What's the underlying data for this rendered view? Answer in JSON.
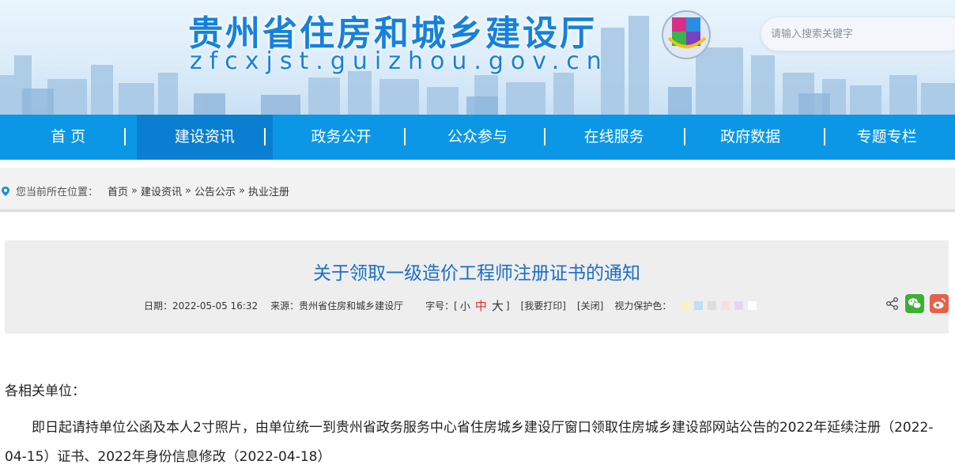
{
  "header": {
    "site_title": "贵州省住房和城乡建设厅",
    "site_url": "zfcxjst.guizhou.gov.cn",
    "search_placeholder": "请输入搜索关键字"
  },
  "nav": {
    "items": [
      {
        "label": "首 页"
      },
      {
        "label": "建设资讯"
      },
      {
        "label": "政务公开"
      },
      {
        "label": "公众参与"
      },
      {
        "label": "在线服务"
      },
      {
        "label": "政府数据"
      },
      {
        "label": "专题专栏"
      }
    ],
    "active_index": 1
  },
  "breadcrumb": {
    "prefix": "您当前所在位置：",
    "items": [
      "首页",
      "建设资讯",
      "公告公示",
      "执业注册"
    ],
    "separator": "»"
  },
  "article": {
    "title": "关于领取一级造价工程师注册证书的通知",
    "date_label": "日期：2022-05-05 16:32",
    "source_label": "来源：贵州省住房和城乡建设厅",
    "font_label": "字号：[",
    "font_small": "小",
    "font_mid": "中",
    "font_large": "大",
    "font_close": "]",
    "print_label": "[我要打印]",
    "close_label": "[关闭]",
    "eye_label": "视力保护色：",
    "swatches": [
      "#f9f3c0",
      "#bde0f2",
      "#dddddd",
      "#f8dde1",
      "#e5d5f3",
      "#ffffff"
    ],
    "salutation": "各相关单位：",
    "paragraph": "即日起请持单位公函及本人2寸照片，由单位统一到贵州省政务服务中心省住房城乡建设厅窗口领取住房城乡建设部网站公告的2022年延续注册（2022-04-15）证书、2022年身份信息修改（2022-04-18）"
  }
}
